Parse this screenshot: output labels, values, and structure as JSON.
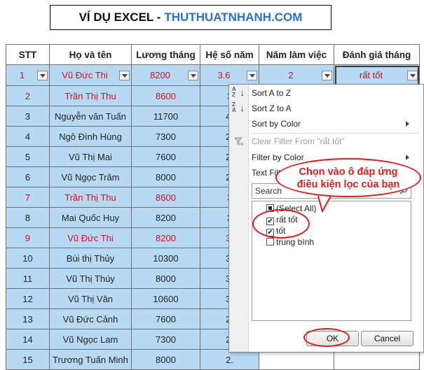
{
  "title": {
    "part1": "VÍ DỤ EXCEL - ",
    "part2": "THUTHUATNHANH.COM"
  },
  "table": {
    "headers": [
      "STT",
      "Họ và tên",
      "Lương tháng",
      "Hệ số năm",
      "Năm làm việc",
      "Đánh giá tháng"
    ],
    "filter_row": [
      "1",
      "Vũ Đức Thi",
      "8200",
      "3.6",
      "2",
      "rất tốt"
    ],
    "rows": [
      [
        "2",
        "Trần Thị Thu",
        "8600",
        "3",
        "",
        ""
      ],
      [
        "3",
        "Nguyễn văn Tuấn",
        "11700",
        "4.",
        "",
        ""
      ],
      [
        "4",
        "Ngô Đình Hùng",
        "7300",
        "2.",
        "",
        ""
      ],
      [
        "5",
        "Vũ Thị Mai",
        "7600",
        "2.",
        "",
        ""
      ],
      [
        "6",
        "Vũ Ngọc Trâm",
        "8000",
        "2.",
        "",
        ""
      ],
      [
        "7",
        "Trần Thị Thu",
        "8600",
        "3",
        "",
        ""
      ],
      [
        "8",
        "Mai Quốc Huy",
        "8200",
        "3",
        "",
        ""
      ],
      [
        "9",
        "Vũ Đức Thi",
        "8200",
        "3.",
        "",
        ""
      ],
      [
        "10",
        "Bùi thị Thủy",
        "10300",
        "3.",
        "",
        ""
      ],
      [
        "11",
        "Vũ Thị Thúy",
        "8000",
        "3.",
        "",
        ""
      ],
      [
        "12",
        "Vũ Thị Vân",
        "10600",
        "3.",
        "",
        ""
      ],
      [
        "13",
        "Vũ Đức Cảnh",
        "7600",
        "2.",
        "",
        ""
      ],
      [
        "14",
        "Vũ Ngọc Lam",
        "7300",
        "2.",
        "",
        ""
      ],
      [
        "15",
        "Trương Tuấn Minh",
        "8000",
        "2.",
        "",
        ""
      ]
    ],
    "red_rows": [
      0,
      5,
      7
    ]
  },
  "filter_menu": {
    "sort_a_z": "Sort A to Z",
    "sort_z_a": "Sort Z to A",
    "sort_by_color": "Sort by Color",
    "clear_filter": "Clear Filter From \"rất tốt\"",
    "filter_by_color": "Filter by Color",
    "text_filters": "Text Filters",
    "search_placeholder": "Search",
    "select_all": "(Select All)",
    "options": [
      {
        "label": "rất tốt",
        "checked": true
      },
      {
        "label": "tốt",
        "checked": true
      },
      {
        "label": "trung bình",
        "checked": false
      }
    ],
    "ok_label": "OK",
    "cancel_label": "Cancel"
  },
  "annotation": {
    "callout_line1": "Chọn vào ô đáp ứng",
    "callout_line2": "điều kiện lọc của bạn"
  },
  "colors": {
    "header_blue": "#b7d9f3",
    "accent_red": "#e01b1b",
    "brand_blue": "#2a6fd6"
  }
}
